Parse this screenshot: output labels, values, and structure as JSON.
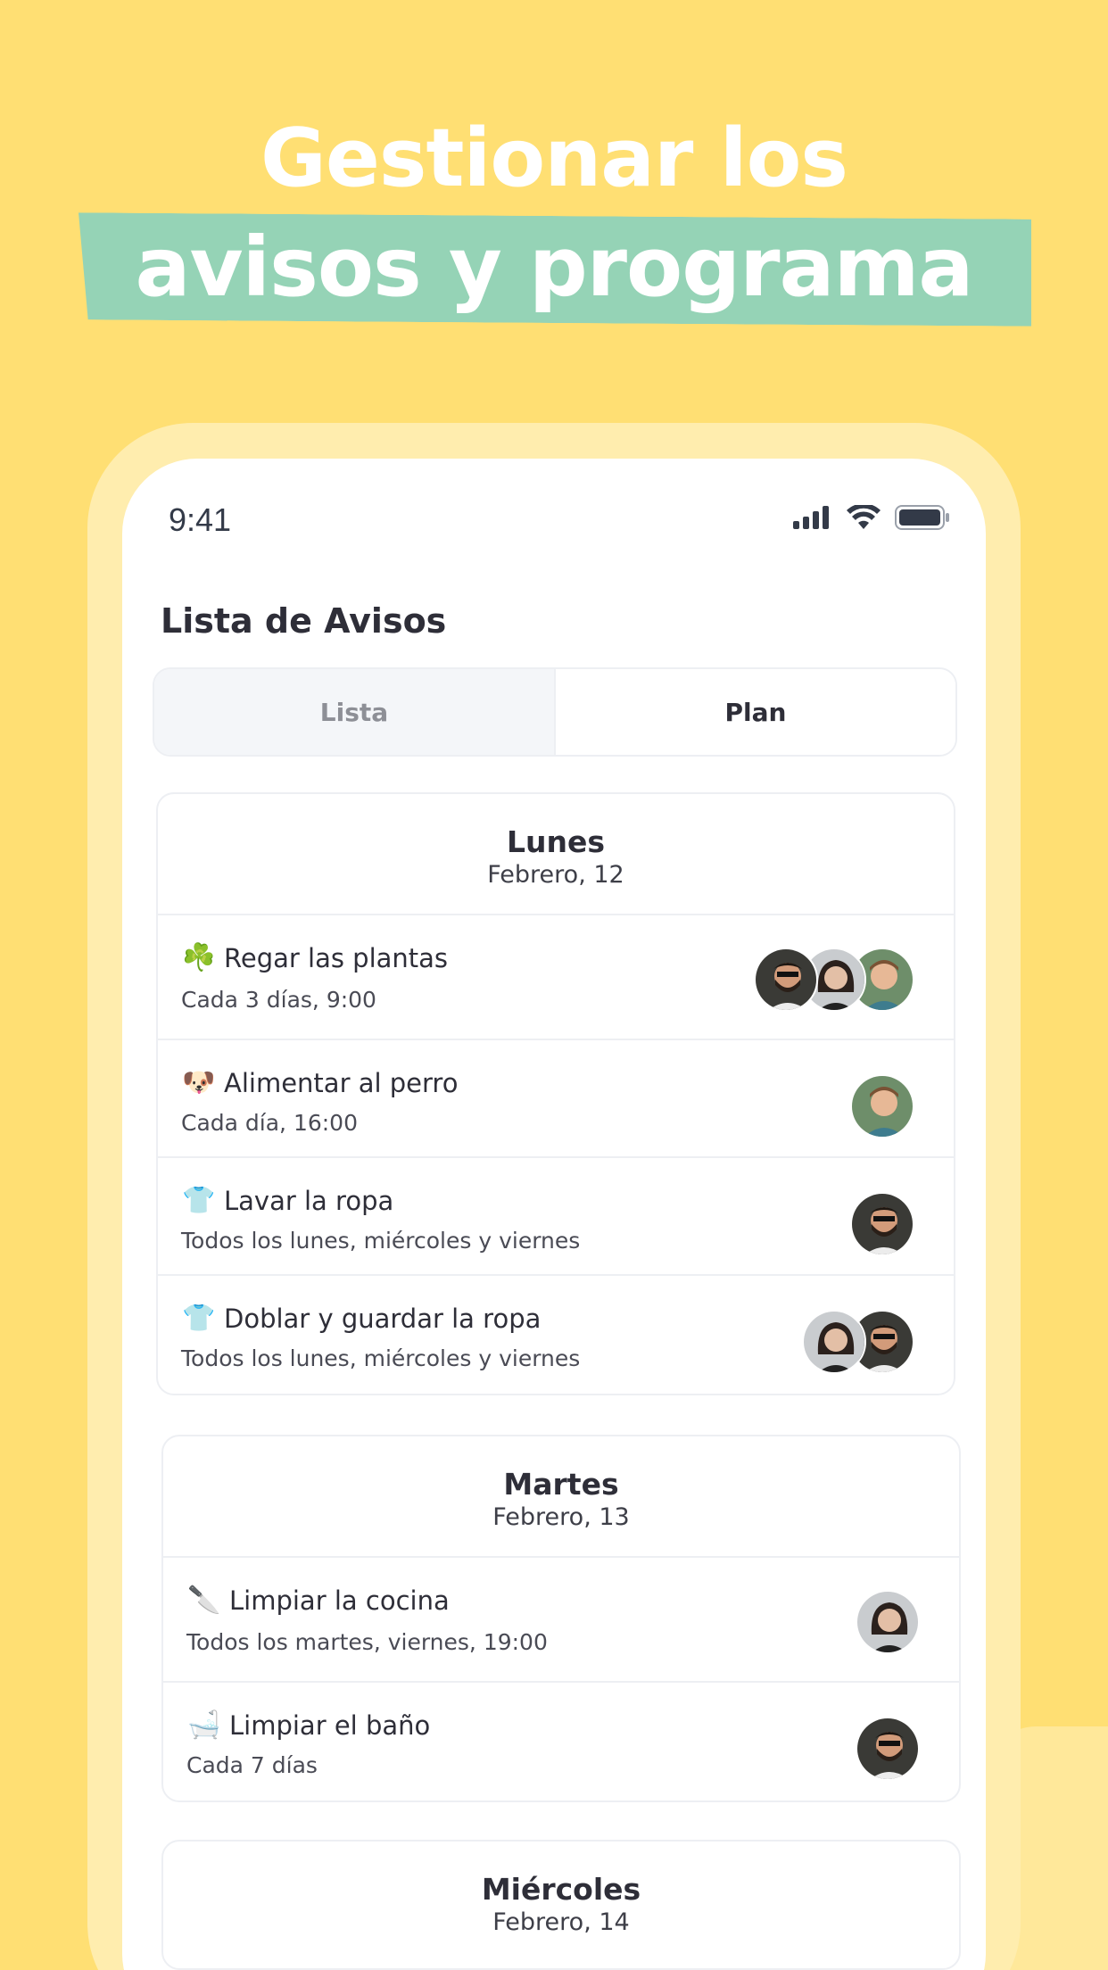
{
  "headline": {
    "line1": "Gestionar los",
    "line2": "avisos y programa"
  },
  "status_bar": {
    "time": "9:41",
    "icons": [
      "signal-icon",
      "wifi-icon",
      "battery-icon"
    ]
  },
  "screen": {
    "title": "Lista de Avisos",
    "tabs": [
      {
        "label": "Lista",
        "selected": false
      },
      {
        "label": "Plan",
        "selected": true
      }
    ]
  },
  "days": [
    {
      "name": "Lunes",
      "date": "Febrero, 12",
      "tasks": [
        {
          "emoji": "☘️",
          "icon": "clover-icon",
          "title": "Regar las plantas",
          "subtitle": "Cada 3 días, 9:00",
          "assignees": [
            "man-beard",
            "woman",
            "boy"
          ]
        },
        {
          "emoji": "🐶",
          "icon": "dog-icon",
          "title": "Alimentar al perro",
          "subtitle": "Cada día, 16:00",
          "assignees": [
            "boy"
          ]
        },
        {
          "emoji": "👕",
          "icon": "shirt-icon",
          "title": "Lavar la ropa",
          "subtitle": "Todos los lunes, miércoles y viernes",
          "assignees": [
            "man-beard"
          ]
        },
        {
          "emoji": "👕",
          "icon": "shirt-icon",
          "title": "Doblar y guardar la ropa",
          "subtitle": "Todos los lunes, miércoles y viernes",
          "assignees": [
            "woman",
            "man-beard"
          ]
        }
      ]
    },
    {
      "name": "Martes",
      "date": "Febrero, 13",
      "tasks": [
        {
          "emoji": "🔪",
          "icon": "knife-icon",
          "title": "Limpiar la cocina",
          "subtitle": "Todos los martes, viernes, 19:00",
          "assignees": [
            "woman"
          ]
        },
        {
          "emoji": "🛁",
          "icon": "bathtub-icon",
          "title": "Limpiar el baño",
          "subtitle": "Cada 7 días",
          "assignees": [
            "man-beard"
          ]
        }
      ]
    },
    {
      "name": "Miércoles",
      "date": "Febrero, 14",
      "tasks": []
    }
  ],
  "colors": {
    "background": "#FFDF73",
    "band": "#95D3B6",
    "text": "#2E2E38"
  }
}
